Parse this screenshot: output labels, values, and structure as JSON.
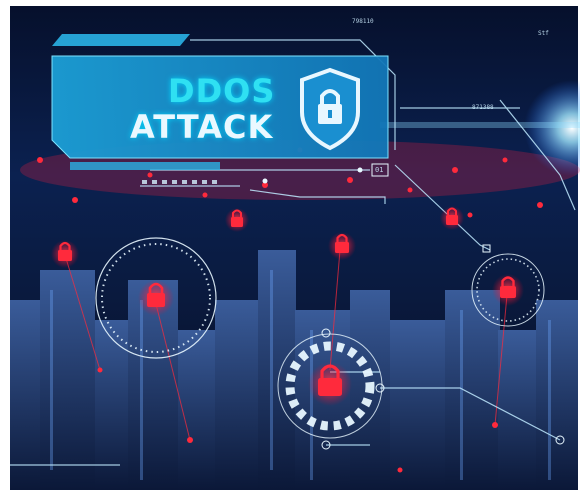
{
  "headline": {
    "line1": "DDOS",
    "line2": "ATTACK"
  },
  "hud_readouts": [
    "798110",
    "871388",
    "Stf"
  ],
  "hud_tag": "01",
  "colors": {
    "cyan": "#2fe0f2",
    "panel": "#1aa9d8",
    "lock_red": "#ff2a3c",
    "night_blue": "#0a1a3c",
    "white_text": "#eaf8ff"
  },
  "icons": [
    "shield-lock-icon",
    "padlock-icon"
  ]
}
